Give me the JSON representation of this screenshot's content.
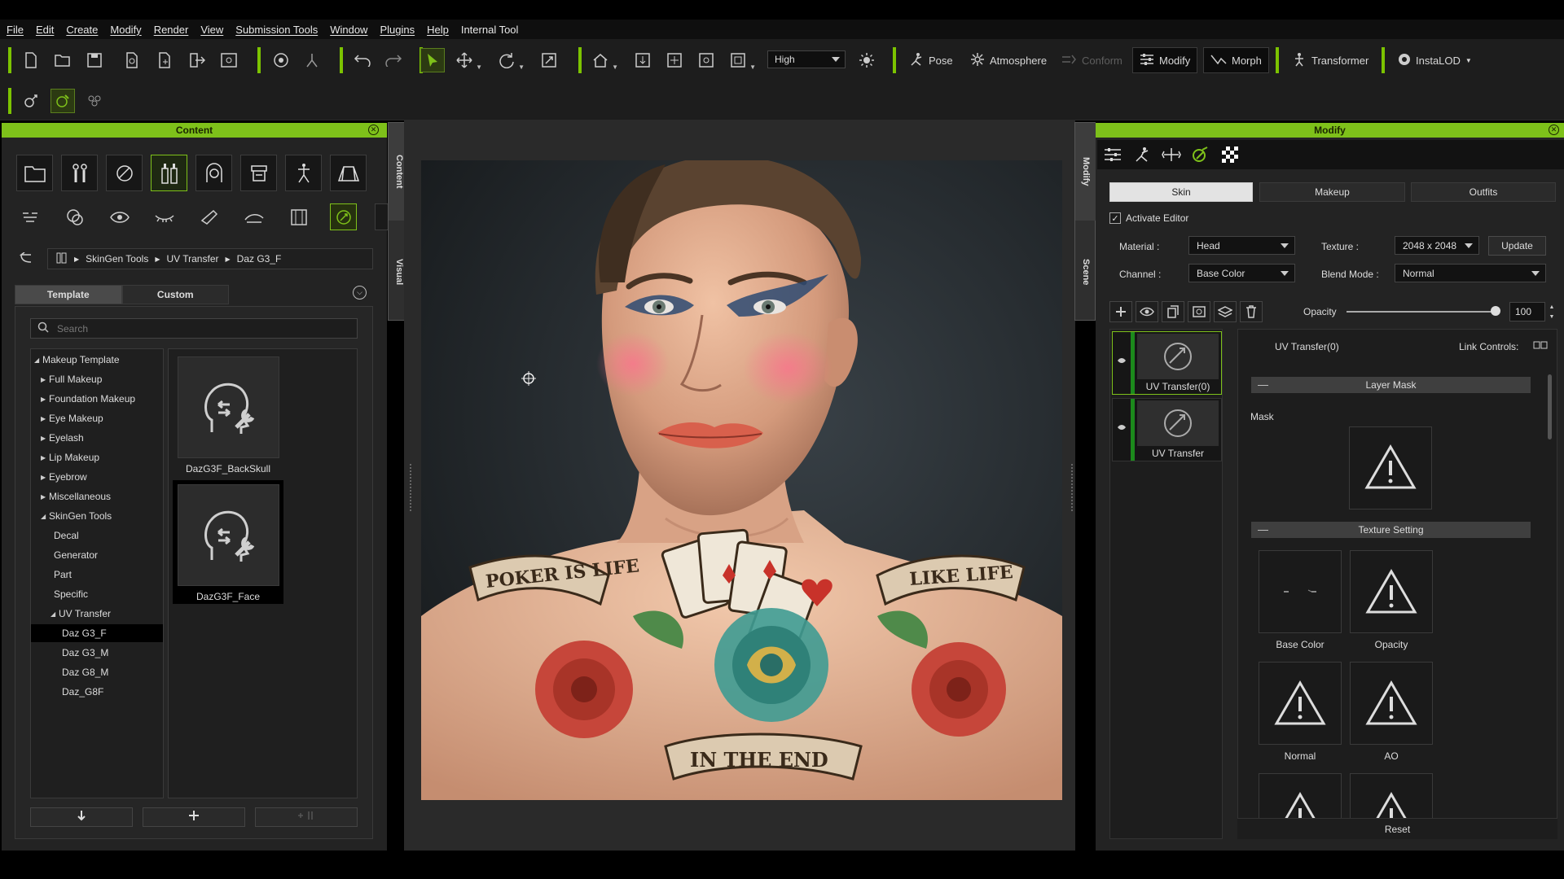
{
  "menu": [
    "File",
    "Edit",
    "Create",
    "Modify",
    "Render",
    "View",
    "Submission Tools",
    "Window",
    "Plugins",
    "Help",
    "Internal Tool"
  ],
  "toolbar": {
    "quality": "High",
    "pose": "Pose",
    "atmosphere": "Atmosphere",
    "conform": "Conform",
    "modify": "Modify",
    "morph": "Morph",
    "transformer": "Transformer",
    "instalod": "InstaLOD"
  },
  "content_panel": {
    "title": "Content",
    "side_tabs": {
      "content": "Content",
      "visual": "Visual"
    },
    "breadcrumb": [
      "SkinGen Tools",
      "UV Transfer",
      "Daz G3_F"
    ],
    "tabs": {
      "template": "Template",
      "custom": "Custom"
    },
    "search_placeholder": "Search",
    "tree": [
      {
        "label": "Makeup Template",
        "level": 0,
        "open": true
      },
      {
        "label": "Full Makeup",
        "level": 1
      },
      {
        "label": "Foundation Makeup",
        "level": 1
      },
      {
        "label": "Eye Makeup",
        "level": 1
      },
      {
        "label": "Eyelash",
        "level": 1
      },
      {
        "label": "Lip Makeup",
        "level": 1
      },
      {
        "label": "Eyebrow",
        "level": 1
      },
      {
        "label": "Miscellaneous",
        "level": 1
      },
      {
        "label": "SkinGen Tools",
        "level": 1,
        "open": true
      },
      {
        "label": "Decal",
        "level": 2
      },
      {
        "label": "Generator",
        "level": 2
      },
      {
        "label": "Part",
        "level": 2
      },
      {
        "label": "Specific",
        "level": 2
      },
      {
        "label": "UV Transfer",
        "level": 2,
        "open": true
      },
      {
        "label": "Daz G3_F",
        "level": 3,
        "selected": true
      },
      {
        "label": "Daz G3_M",
        "level": 3
      },
      {
        "label": "Daz G8_M",
        "level": 3
      },
      {
        "label": "Daz_G8F",
        "level": 3
      }
    ],
    "thumbnails": [
      {
        "label": "DazG3F_BackSkull",
        "selected": false
      },
      {
        "label": "DazG3F_Face",
        "selected": true
      }
    ]
  },
  "viewport": {
    "side_tabs": {
      "modify": "Modify",
      "scene": "Scene"
    },
    "tattoo_text": {
      "left": "POKER IS LIFE",
      "right": "LIKE LIFE",
      "bottom": "IN THE END"
    }
  },
  "modify_panel": {
    "title": "Modify",
    "tabs": {
      "skin": "Skin",
      "makeup": "Makeup",
      "outfits": "Outfits"
    },
    "activate_editor": "Activate Editor",
    "material_label": "Material :",
    "material_value": "Head",
    "texture_label": "Texture :",
    "texture_value": "2048 x 2048",
    "update": "Update",
    "channel_label": "Channel :",
    "channel_value": "Base Color",
    "blend_label": "Blend Mode :",
    "blend_value": "Normal",
    "opacity_label": "Opacity",
    "opacity_value": "100",
    "layers": [
      {
        "label": "UV Transfer(0)",
        "selected": true
      },
      {
        "label": "UV Transfer",
        "selected": false
      }
    ],
    "detail_title": "UV Transfer(0)",
    "link_controls": "Link Controls:",
    "layer_mask": "Layer Mask",
    "mask": "Mask",
    "texture_setting": "Texture Setting",
    "textures": [
      "Base Color",
      "Opacity",
      "Normal",
      "AO"
    ],
    "reset": "Reset"
  },
  "colors": {
    "accent": "#7ec11a",
    "panel": "#232323",
    "toolbar": "#1d1d1d"
  }
}
